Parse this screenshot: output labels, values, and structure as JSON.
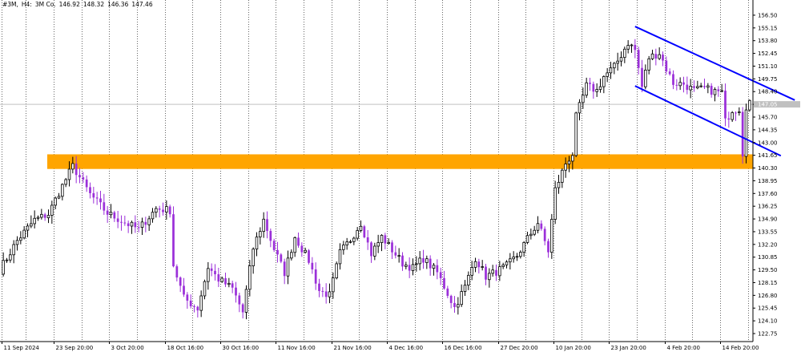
{
  "header": {
    "symbol": "#3M,",
    "timeframe": "H4:",
    "name": "3M Co.",
    "open": "146.92",
    "high": "148.32",
    "low": "146.36",
    "close": "147.46"
  },
  "current_price_label": "147.05",
  "colors": {
    "bull_candle": "#000000",
    "bull_fill": "#ffffff",
    "bear_candle": "#9b30d9",
    "zone": "#ffa500",
    "channel": "#0000ff",
    "grid": "#000000",
    "current_price_line": "#c0c0c0"
  },
  "chart_data": {
    "type": "candlestick",
    "timeframe": "H4",
    "y_ticks": [
      "156.50",
      "155.15",
      "153.80",
      "152.45",
      "151.10",
      "149.75",
      "148.40",
      "147.05",
      "145.70",
      "144.35",
      "143.00",
      "141.65",
      "140.30",
      "138.95",
      "137.60",
      "136.25",
      "134.90",
      "133.55",
      "132.20",
      "130.85",
      "129.50",
      "128.15",
      "126.80",
      "125.45",
      "124.10",
      "122.75"
    ],
    "x_ticks": [
      "11 Sep 2024",
      "23 Sep 20:00",
      "3 Oct 20:00",
      "18 Oct 16:00",
      "30 Oct 16:00",
      "11 Nov 16:00",
      "21 Nov 16:00",
      "4 Dec 16:00",
      "16 Dec 16:00",
      "27 Dec 20:00",
      "10 Jan 20:00",
      "23 Jan 20:00",
      "4 Feb 20:00",
      "14 Feb 20:00"
    ],
    "ylim": [
      121.9,
      157.6
    ],
    "candle_count": 216,
    "last_close": 147.46,
    "zone": {
      "low": 140.2,
      "high": 141.75,
      "label": "support/resistance zone"
    },
    "channel": {
      "upper": {
        "from": [
          182,
          155.3
        ],
        "to": [
          228,
          147.5
        ]
      },
      "lower": {
        "from": [
          182,
          149.0
        ],
        "to": [
          224,
          141.6
        ]
      }
    },
    "anchors": [
      [
        0,
        129.5
      ],
      [
        5,
        132.6
      ],
      [
        10,
        134.8
      ],
      [
        14,
        135.4
      ],
      [
        17,
        137.7
      ],
      [
        21,
        140.5
      ],
      [
        26,
        137.5
      ],
      [
        31,
        135.5
      ],
      [
        36,
        134.5
      ],
      [
        40,
        133.8
      ],
      [
        45,
        136.0
      ],
      [
        49,
        135.8
      ],
      [
        50,
        130.0
      ],
      [
        53,
        126.5
      ],
      [
        57,
        125.4
      ],
      [
        60,
        129.8
      ],
      [
        63,
        128.5
      ],
      [
        67,
        127.5
      ],
      [
        70,
        125.0
      ],
      [
        73,
        131.8
      ],
      [
        76,
        134.8
      ],
      [
        79,
        131.7
      ],
      [
        82,
        129.2
      ],
      [
        85,
        133.0
      ],
      [
        89,
        130.5
      ],
      [
        92,
        127.3
      ],
      [
        95,
        126.8
      ],
      [
        98,
        131.3
      ],
      [
        101,
        132.7
      ],
      [
        104,
        134.5
      ],
      [
        107,
        131.2
      ],
      [
        110,
        133.0
      ],
      [
        113,
        131.6
      ],
      [
        116,
        130.2
      ],
      [
        119,
        129.7
      ],
      [
        122,
        130.7
      ],
      [
        126,
        129.2
      ],
      [
        129,
        127.0
      ],
      [
        131,
        125.5
      ],
      [
        134,
        127.7
      ],
      [
        137,
        130.8
      ],
      [
        140,
        128.8
      ],
      [
        143,
        129.3
      ],
      [
        146,
        129.9
      ],
      [
        149,
        131.0
      ],
      [
        152,
        132.8
      ],
      [
        155,
        134.5
      ],
      [
        158,
        131.5
      ],
      [
        160,
        138.0
      ],
      [
        163,
        140.8
      ],
      [
        165,
        141.8
      ],
      [
        166,
        145.7
      ],
      [
        169,
        149.0
      ],
      [
        172,
        148.5
      ],
      [
        174,
        150.0
      ],
      [
        177,
        151.0
      ],
      [
        181,
        153.6
      ],
      [
        183,
        152.8
      ],
      [
        185,
        148.9
      ],
      [
        187,
        152.0
      ],
      [
        190,
        152.5
      ],
      [
        192,
        150.8
      ],
      [
        194,
        149.3
      ],
      [
        197,
        149.2
      ],
      [
        200,
        148.5
      ],
      [
        203,
        148.7
      ],
      [
        206,
        148.4
      ],
      [
        208,
        148.3
      ],
      [
        209,
        145.2
      ],
      [
        211,
        146.5
      ],
      [
        213,
        146.6
      ],
      [
        214,
        141.9
      ],
      [
        215,
        146.9
      ],
      [
        216,
        147.46
      ]
    ]
  }
}
